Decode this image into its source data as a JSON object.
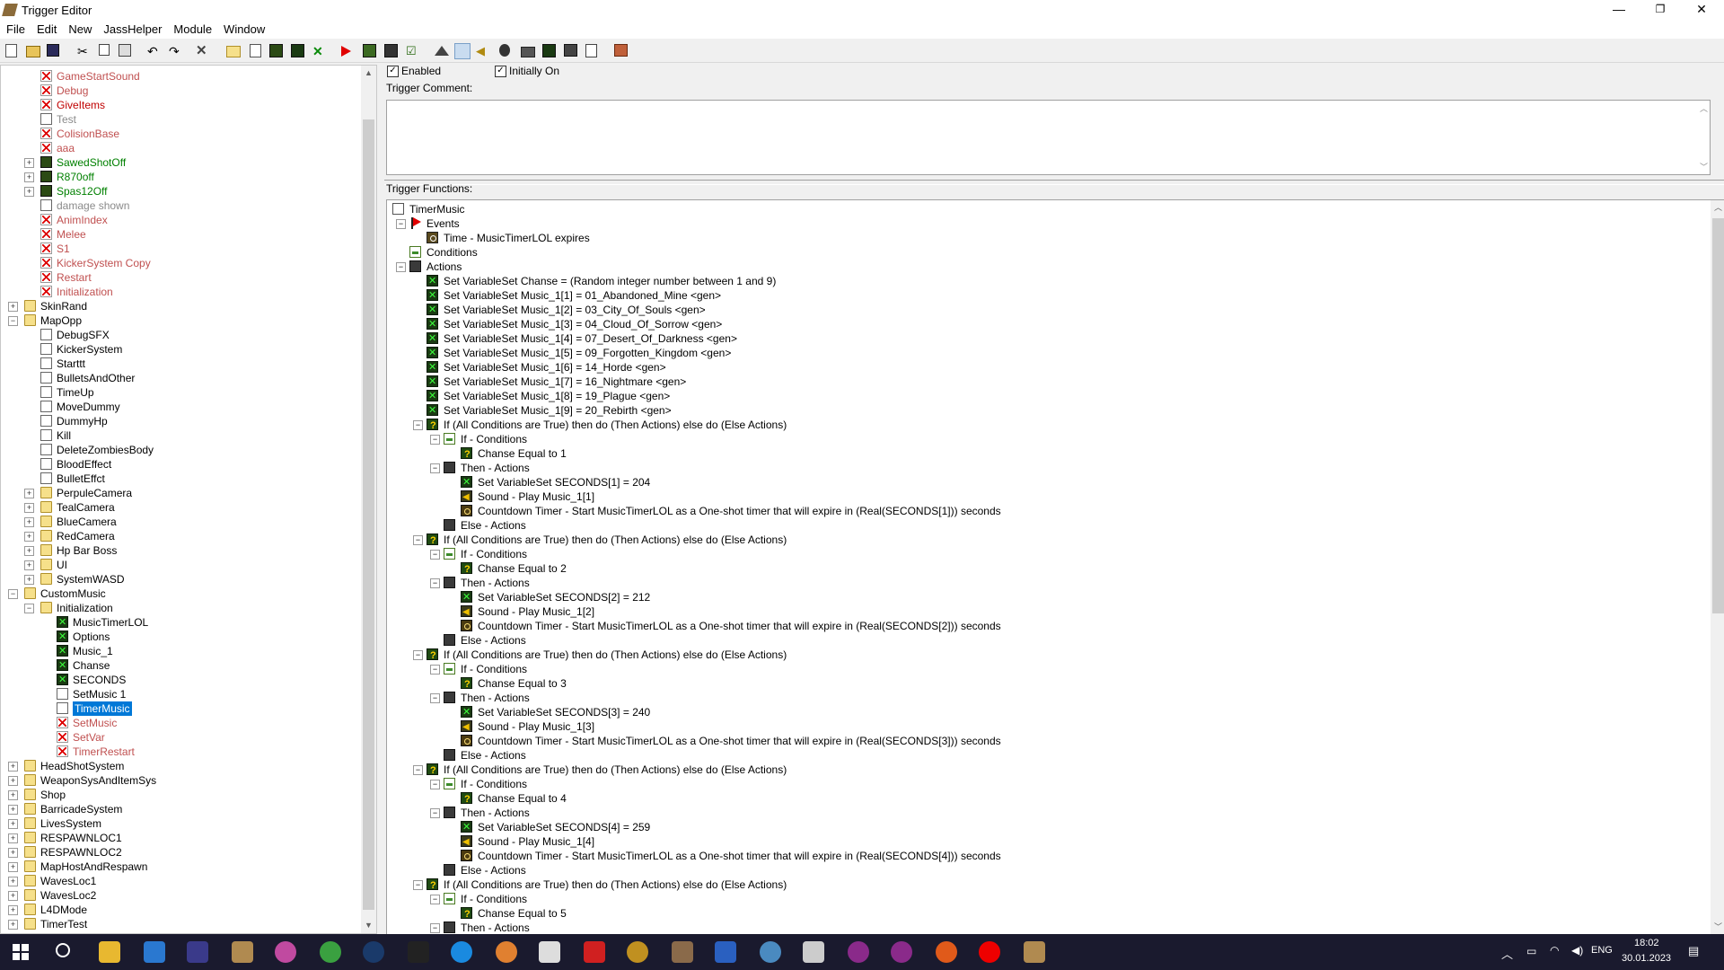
{
  "window": {
    "title": "Trigger Editor",
    "minimize": "—",
    "maximize": "❐",
    "close": "✕"
  },
  "menu": [
    "File",
    "Edit",
    "New",
    "JassHelper",
    "Module",
    "Window"
  ],
  "trigger_props": {
    "enabled_label": "Enabled",
    "initially_on_label": "Initially On",
    "comment_label": "Trigger Comment:",
    "comment_value": "",
    "functions_label": "Trigger Functions:"
  },
  "tree": [
    {
      "label": "GameStartSound",
      "icon": "disabled-trigger-icon",
      "style": "red",
      "level": 2,
      "expander": ""
    },
    {
      "label": "Debug",
      "icon": "disabled-trigger-icon",
      "style": "red",
      "level": 2,
      "expander": ""
    },
    {
      "label": "GiveItems",
      "icon": "disabled-trigger-icon",
      "style": "darkred",
      "level": 2,
      "expander": ""
    },
    {
      "label": "Test",
      "icon": "trigger-icon",
      "style": "gray",
      "level": 2,
      "expander": ""
    },
    {
      "label": "ColisionBase",
      "icon": "disabled-trigger-icon",
      "style": "red",
      "level": 2,
      "expander": ""
    },
    {
      "label": "aaa",
      "icon": "disabled-trigger-icon",
      "style": "red",
      "level": 2,
      "expander": ""
    },
    {
      "label": "SawedShotOff",
      "icon": "config-icon",
      "style": "green",
      "level": 2,
      "expander": "+"
    },
    {
      "label": "R870off",
      "icon": "config-icon",
      "style": "green",
      "level": 2,
      "expander": "+"
    },
    {
      "label": "Spas12Off",
      "icon": "config-icon",
      "style": "green",
      "level": 2,
      "expander": "+"
    },
    {
      "label": "damage shown",
      "icon": "trigger-icon",
      "style": "gray",
      "level": 2,
      "expander": ""
    },
    {
      "label": "AnimIndex",
      "icon": "disabled-trigger-icon",
      "style": "red",
      "level": 2,
      "expander": ""
    },
    {
      "label": "Melee",
      "icon": "disabled-trigger-icon",
      "style": "red",
      "level": 2,
      "expander": ""
    },
    {
      "label": "S1",
      "icon": "disabled-trigger-icon",
      "style": "red",
      "level": 2,
      "expander": ""
    },
    {
      "label": "KickerSystem Copy",
      "icon": "disabled-trigger-icon",
      "style": "red",
      "level": 2,
      "expander": ""
    },
    {
      "label": "Restart",
      "icon": "disabled-trigger-icon",
      "style": "red",
      "level": 2,
      "expander": ""
    },
    {
      "label": "Initialization",
      "icon": "disabled-trigger-icon",
      "style": "red",
      "level": 2,
      "expander": ""
    },
    {
      "label": "SkinRand",
      "icon": "folder-icon",
      "style": "",
      "level": 1,
      "expander": "+"
    },
    {
      "label": "MapOpp",
      "icon": "folder-icon",
      "style": "",
      "level": 1,
      "expander": "−"
    },
    {
      "label": "DebugSFX",
      "icon": "trigger-icon",
      "style": "",
      "level": 2,
      "expander": ""
    },
    {
      "label": "KickerSystem",
      "icon": "trigger-icon",
      "style": "",
      "level": 2,
      "expander": ""
    },
    {
      "label": "Starttt",
      "icon": "trigger-icon",
      "style": "",
      "level": 2,
      "expander": ""
    },
    {
      "label": "BulletsAndOther",
      "icon": "trigger-icon",
      "style": "",
      "level": 2,
      "expander": ""
    },
    {
      "label": "TimeUp",
      "icon": "trigger-icon",
      "style": "",
      "level": 2,
      "expander": ""
    },
    {
      "label": "MoveDummy",
      "icon": "trigger-icon",
      "style": "",
      "level": 2,
      "expander": ""
    },
    {
      "label": "DummyHp",
      "icon": "trigger-icon",
      "style": "",
      "level": 2,
      "expander": ""
    },
    {
      "label": "Kill",
      "icon": "trigger-icon",
      "style": "",
      "level": 2,
      "expander": ""
    },
    {
      "label": "DeleteZombiesBody",
      "icon": "trigger-icon",
      "style": "",
      "level": 2,
      "expander": ""
    },
    {
      "label": "BloodEffect",
      "icon": "trigger-icon",
      "style": "",
      "level": 2,
      "expander": ""
    },
    {
      "label": "BulletEffct",
      "icon": "trigger-icon",
      "style": "",
      "level": 2,
      "expander": ""
    },
    {
      "label": "PerpuleCamera",
      "icon": "folder-icon",
      "style": "",
      "level": 2,
      "expander": "+"
    },
    {
      "label": "TealCamera",
      "icon": "folder-icon",
      "style": "",
      "level": 2,
      "expander": "+"
    },
    {
      "label": "BlueCamera",
      "icon": "folder-icon",
      "style": "",
      "level": 2,
      "expander": "+"
    },
    {
      "label": "RedCamera",
      "icon": "folder-icon",
      "style": "",
      "level": 2,
      "expander": "+"
    },
    {
      "label": "Hp Bar Boss",
      "icon": "folder-icon",
      "style": "",
      "level": 2,
      "expander": "+"
    },
    {
      "label": "UI",
      "icon": "folder-icon",
      "style": "",
      "level": 2,
      "expander": "+"
    },
    {
      "label": "SystemWASD",
      "icon": "folder-icon",
      "style": "",
      "level": 2,
      "expander": "+"
    },
    {
      "label": "CustomMusic",
      "icon": "folder-icon",
      "style": "",
      "level": 1,
      "expander": "−"
    },
    {
      "label": "Initialization",
      "icon": "folder-icon",
      "style": "",
      "level": 2,
      "expander": "−"
    },
    {
      "label": "MusicTimerLOL",
      "icon": "variable-icon",
      "style": "",
      "level": 3,
      "expander": ""
    },
    {
      "label": "Options",
      "icon": "variable-icon",
      "style": "",
      "level": 3,
      "expander": ""
    },
    {
      "label": "Music_1",
      "icon": "variable-icon",
      "style": "",
      "level": 3,
      "expander": ""
    },
    {
      "label": "Chanse",
      "icon": "variable-icon",
      "style": "",
      "level": 3,
      "expander": ""
    },
    {
      "label": "SECONDS",
      "icon": "variable-icon",
      "style": "",
      "level": 3,
      "expander": ""
    },
    {
      "label": "SetMusic 1",
      "icon": "trigger-icon",
      "style": "",
      "level": 3,
      "expander": ""
    },
    {
      "label": "TimerMusic",
      "icon": "trigger-icon",
      "style": "selected",
      "level": 3,
      "expander": ""
    },
    {
      "label": "SetMusic",
      "icon": "disabled-trigger-icon",
      "style": "red",
      "level": 3,
      "expander": ""
    },
    {
      "label": "SetVar",
      "icon": "disabled-trigger-icon",
      "style": "red",
      "level": 3,
      "expander": ""
    },
    {
      "label": "TimerRestart",
      "icon": "disabled-trigger-icon",
      "style": "red",
      "level": 3,
      "expander": ""
    },
    {
      "label": "HeadShotSystem",
      "icon": "folder-icon",
      "style": "",
      "level": 1,
      "expander": "+"
    },
    {
      "label": "WeaponSysAndItemSys",
      "icon": "folder-icon",
      "style": "",
      "level": 1,
      "expander": "+"
    },
    {
      "label": "Shop",
      "icon": "folder-icon",
      "style": "",
      "level": 1,
      "expander": "+"
    },
    {
      "label": "BarricadeSystem",
      "icon": "folder-icon",
      "style": "",
      "level": 1,
      "expander": "+"
    },
    {
      "label": "LivesSystem",
      "icon": "folder-icon",
      "style": "",
      "level": 1,
      "expander": "+"
    },
    {
      "label": "RESPAWNLOC1",
      "icon": "folder-icon",
      "style": "",
      "level": 1,
      "expander": "+"
    },
    {
      "label": "RESPAWNLOC2",
      "icon": "folder-icon",
      "style": "",
      "level": 1,
      "expander": "+"
    },
    {
      "label": "MapHostAndRespawn",
      "icon": "folder-icon",
      "style": "",
      "level": 1,
      "expander": "+"
    },
    {
      "label": "WavesLoc1",
      "icon": "folder-icon",
      "style": "",
      "level": 1,
      "expander": "+"
    },
    {
      "label": "WavesLoc2",
      "icon": "folder-icon",
      "style": "",
      "level": 1,
      "expander": "+"
    },
    {
      "label": "L4DMode",
      "icon": "folder-icon",
      "style": "",
      "level": 1,
      "expander": "+"
    },
    {
      "label": "TimerTest",
      "icon": "folder-icon",
      "style": "",
      "level": 1,
      "expander": "+"
    }
  ],
  "functions": [
    {
      "text": "TimerMusic",
      "icon": "trigger-icon",
      "level": 0,
      "expander": ""
    },
    {
      "text": "Events",
      "icon": "event-icon",
      "level": 1,
      "expander": "−"
    },
    {
      "text": "Time - MusicTimerLOL expires",
      "icon": "timer-icon",
      "level": 2,
      "expander": ""
    },
    {
      "text": "Conditions",
      "icon": "condition-icon",
      "level": 1,
      "expander": ""
    },
    {
      "text": "Actions",
      "icon": "action-icon",
      "level": 1,
      "expander": "−"
    },
    {
      "text": "Set VariableSet Chanse = (Random integer number between 1 and 9)",
      "icon": "set-variable-icon",
      "level": 2,
      "expander": ""
    },
    {
      "text": "Set VariableSet Music_1[1] = 01_Abandoned_Mine <gen>",
      "icon": "set-variable-icon",
      "level": 2,
      "expander": ""
    },
    {
      "text": "Set VariableSet Music_1[2] = 03_City_Of_Souls <gen>",
      "icon": "set-variable-icon",
      "level": 2,
      "expander": ""
    },
    {
      "text": "Set VariableSet Music_1[3] = 04_Cloud_Of_Sorrow <gen>",
      "icon": "set-variable-icon",
      "level": 2,
      "expander": ""
    },
    {
      "text": "Set VariableSet Music_1[4] = 07_Desert_Of_Darkness <gen>",
      "icon": "set-variable-icon",
      "level": 2,
      "expander": ""
    },
    {
      "text": "Set VariableSet Music_1[5] = 09_Forgotten_Kingdom <gen>",
      "icon": "set-variable-icon",
      "level": 2,
      "expander": ""
    },
    {
      "text": "Set VariableSet Music_1[6] = 14_Horde <gen>",
      "icon": "set-variable-icon",
      "level": 2,
      "expander": ""
    },
    {
      "text": "Set VariableSet Music_1[7] = 16_Nightmare <gen>",
      "icon": "set-variable-icon",
      "level": 2,
      "expander": ""
    },
    {
      "text": "Set VariableSet Music_1[8] = 19_Plague <gen>",
      "icon": "set-variable-icon",
      "level": 2,
      "expander": ""
    },
    {
      "text": "Set VariableSet Music_1[9] = 20_Rebirth <gen>",
      "icon": "set-variable-icon",
      "level": 2,
      "expander": ""
    },
    {
      "text": "If (All Conditions are True) then do (Then Actions) else do (Else Actions)",
      "icon": "if-icon",
      "level": 2,
      "expander": "−"
    },
    {
      "text": "If - Conditions",
      "icon": "condition-icon",
      "level": 3,
      "expander": "−"
    },
    {
      "text": "Chanse Equal to 1",
      "icon": "if-icon",
      "level": 4,
      "expander": ""
    },
    {
      "text": "Then - Actions",
      "icon": "action-icon",
      "level": 3,
      "expander": "−"
    },
    {
      "text": "Set VariableSet SECONDS[1] = 204",
      "icon": "set-variable-icon",
      "level": 4,
      "expander": ""
    },
    {
      "text": "Sound - Play Music_1[1]",
      "icon": "sound-icon",
      "level": 4,
      "expander": ""
    },
    {
      "text": "Countdown Timer - Start MusicTimerLOL as a One-shot timer that will expire in (Real(SECONDS[1])) seconds",
      "icon": "countdown-icon",
      "level": 4,
      "expander": ""
    },
    {
      "text": "Else - Actions",
      "icon": "action-icon",
      "level": 3,
      "expander": ""
    },
    {
      "text": "If (All Conditions are True) then do (Then Actions) else do (Else Actions)",
      "icon": "if-icon",
      "level": 2,
      "expander": "−"
    },
    {
      "text": "If - Conditions",
      "icon": "condition-icon",
      "level": 3,
      "expander": "−"
    },
    {
      "text": "Chanse Equal to 2",
      "icon": "if-icon",
      "level": 4,
      "expander": ""
    },
    {
      "text": "Then - Actions",
      "icon": "action-icon",
      "level": 3,
      "expander": "−"
    },
    {
      "text": "Set VariableSet SECONDS[2] = 212",
      "icon": "set-variable-icon",
      "level": 4,
      "expander": ""
    },
    {
      "text": "Sound - Play Music_1[2]",
      "icon": "sound-icon",
      "level": 4,
      "expander": ""
    },
    {
      "text": "Countdown Timer - Start MusicTimerLOL as a One-shot timer that will expire in (Real(SECONDS[2])) seconds",
      "icon": "countdown-icon",
      "level": 4,
      "expander": ""
    },
    {
      "text": "Else - Actions",
      "icon": "action-icon",
      "level": 3,
      "expander": ""
    },
    {
      "text": "If (All Conditions are True) then do (Then Actions) else do (Else Actions)",
      "icon": "if-icon",
      "level": 2,
      "expander": "−"
    },
    {
      "text": "If - Conditions",
      "icon": "condition-icon",
      "level": 3,
      "expander": "−"
    },
    {
      "text": "Chanse Equal to 3",
      "icon": "if-icon",
      "level": 4,
      "expander": ""
    },
    {
      "text": "Then - Actions",
      "icon": "action-icon",
      "level": 3,
      "expander": "−"
    },
    {
      "text": "Set VariableSet SECONDS[3] = 240",
      "icon": "set-variable-icon",
      "level": 4,
      "expander": ""
    },
    {
      "text": "Sound - Play Music_1[3]",
      "icon": "sound-icon",
      "level": 4,
      "expander": ""
    },
    {
      "text": "Countdown Timer - Start MusicTimerLOL as a One-shot timer that will expire in (Real(SECONDS[3])) seconds",
      "icon": "countdown-icon",
      "level": 4,
      "expander": ""
    },
    {
      "text": "Else - Actions",
      "icon": "action-icon",
      "level": 3,
      "expander": ""
    },
    {
      "text": "If (All Conditions are True) then do (Then Actions) else do (Else Actions)",
      "icon": "if-icon",
      "level": 2,
      "expander": "−"
    },
    {
      "text": "If - Conditions",
      "icon": "condition-icon",
      "level": 3,
      "expander": "−"
    },
    {
      "text": "Chanse Equal to 4",
      "icon": "if-icon",
      "level": 4,
      "expander": ""
    },
    {
      "text": "Then - Actions",
      "icon": "action-icon",
      "level": 3,
      "expander": "−"
    },
    {
      "text": "Set VariableSet SECONDS[4] = 259",
      "icon": "set-variable-icon",
      "level": 4,
      "expander": ""
    },
    {
      "text": "Sound - Play Music_1[4]",
      "icon": "sound-icon",
      "level": 4,
      "expander": ""
    },
    {
      "text": "Countdown Timer - Start MusicTimerLOL as a One-shot timer that will expire in (Real(SECONDS[4])) seconds",
      "icon": "countdown-icon",
      "level": 4,
      "expander": ""
    },
    {
      "text": "Else - Actions",
      "icon": "action-icon",
      "level": 3,
      "expander": ""
    },
    {
      "text": "If (All Conditions are True) then do (Then Actions) else do (Else Actions)",
      "icon": "if-icon",
      "level": 2,
      "expander": "−"
    },
    {
      "text": "If - Conditions",
      "icon": "condition-icon",
      "level": 3,
      "expander": "−"
    },
    {
      "text": "Chanse Equal to 5",
      "icon": "if-icon",
      "level": 4,
      "expander": ""
    },
    {
      "text": "Then - Actions",
      "icon": "action-icon",
      "level": 3,
      "expander": "−"
    }
  ],
  "taskbar": {
    "lang": "ENG",
    "time": "18:02",
    "date": "30.01.2023"
  }
}
